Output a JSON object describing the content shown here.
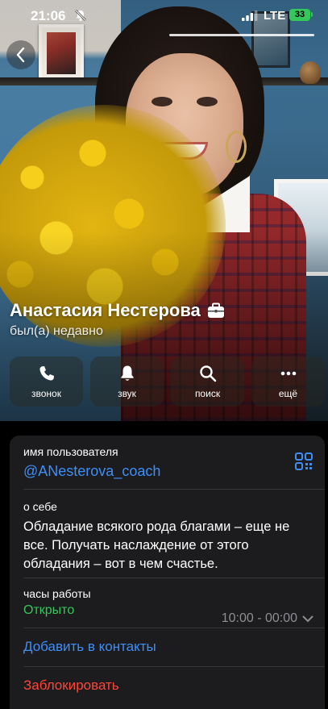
{
  "status_bar": {
    "time": "21:06",
    "network": "LTE",
    "battery": "33"
  },
  "profile": {
    "name": "Анастасия Нестерова",
    "last_seen": "был(а) недавно",
    "badge_icon": "briefcase-icon"
  },
  "actions": [
    {
      "label": "звонок",
      "icon": "phone-icon"
    },
    {
      "label": "звук",
      "icon": "bell-icon"
    },
    {
      "label": "поиск",
      "icon": "search-icon"
    },
    {
      "label": "ещё",
      "icon": "more-icon"
    }
  ],
  "info": {
    "username_label": "имя пользователя",
    "username": "@ANesterova_coach",
    "about_label": "о себе",
    "about": "Обладание всякого рода благами – еще не все. Получать наслаждение от этого обладания – вот в чем счастье.",
    "hours_label": "часы работы",
    "hours_status": "Открыто",
    "hours_value": "10:00 - 00:00",
    "add_contact": "Добавить в контакты",
    "block": "Заблокировать"
  },
  "colors": {
    "link": "#3e8ef6",
    "open": "#34c759",
    "danger": "#ff453a",
    "card": "#1c1c1e"
  }
}
